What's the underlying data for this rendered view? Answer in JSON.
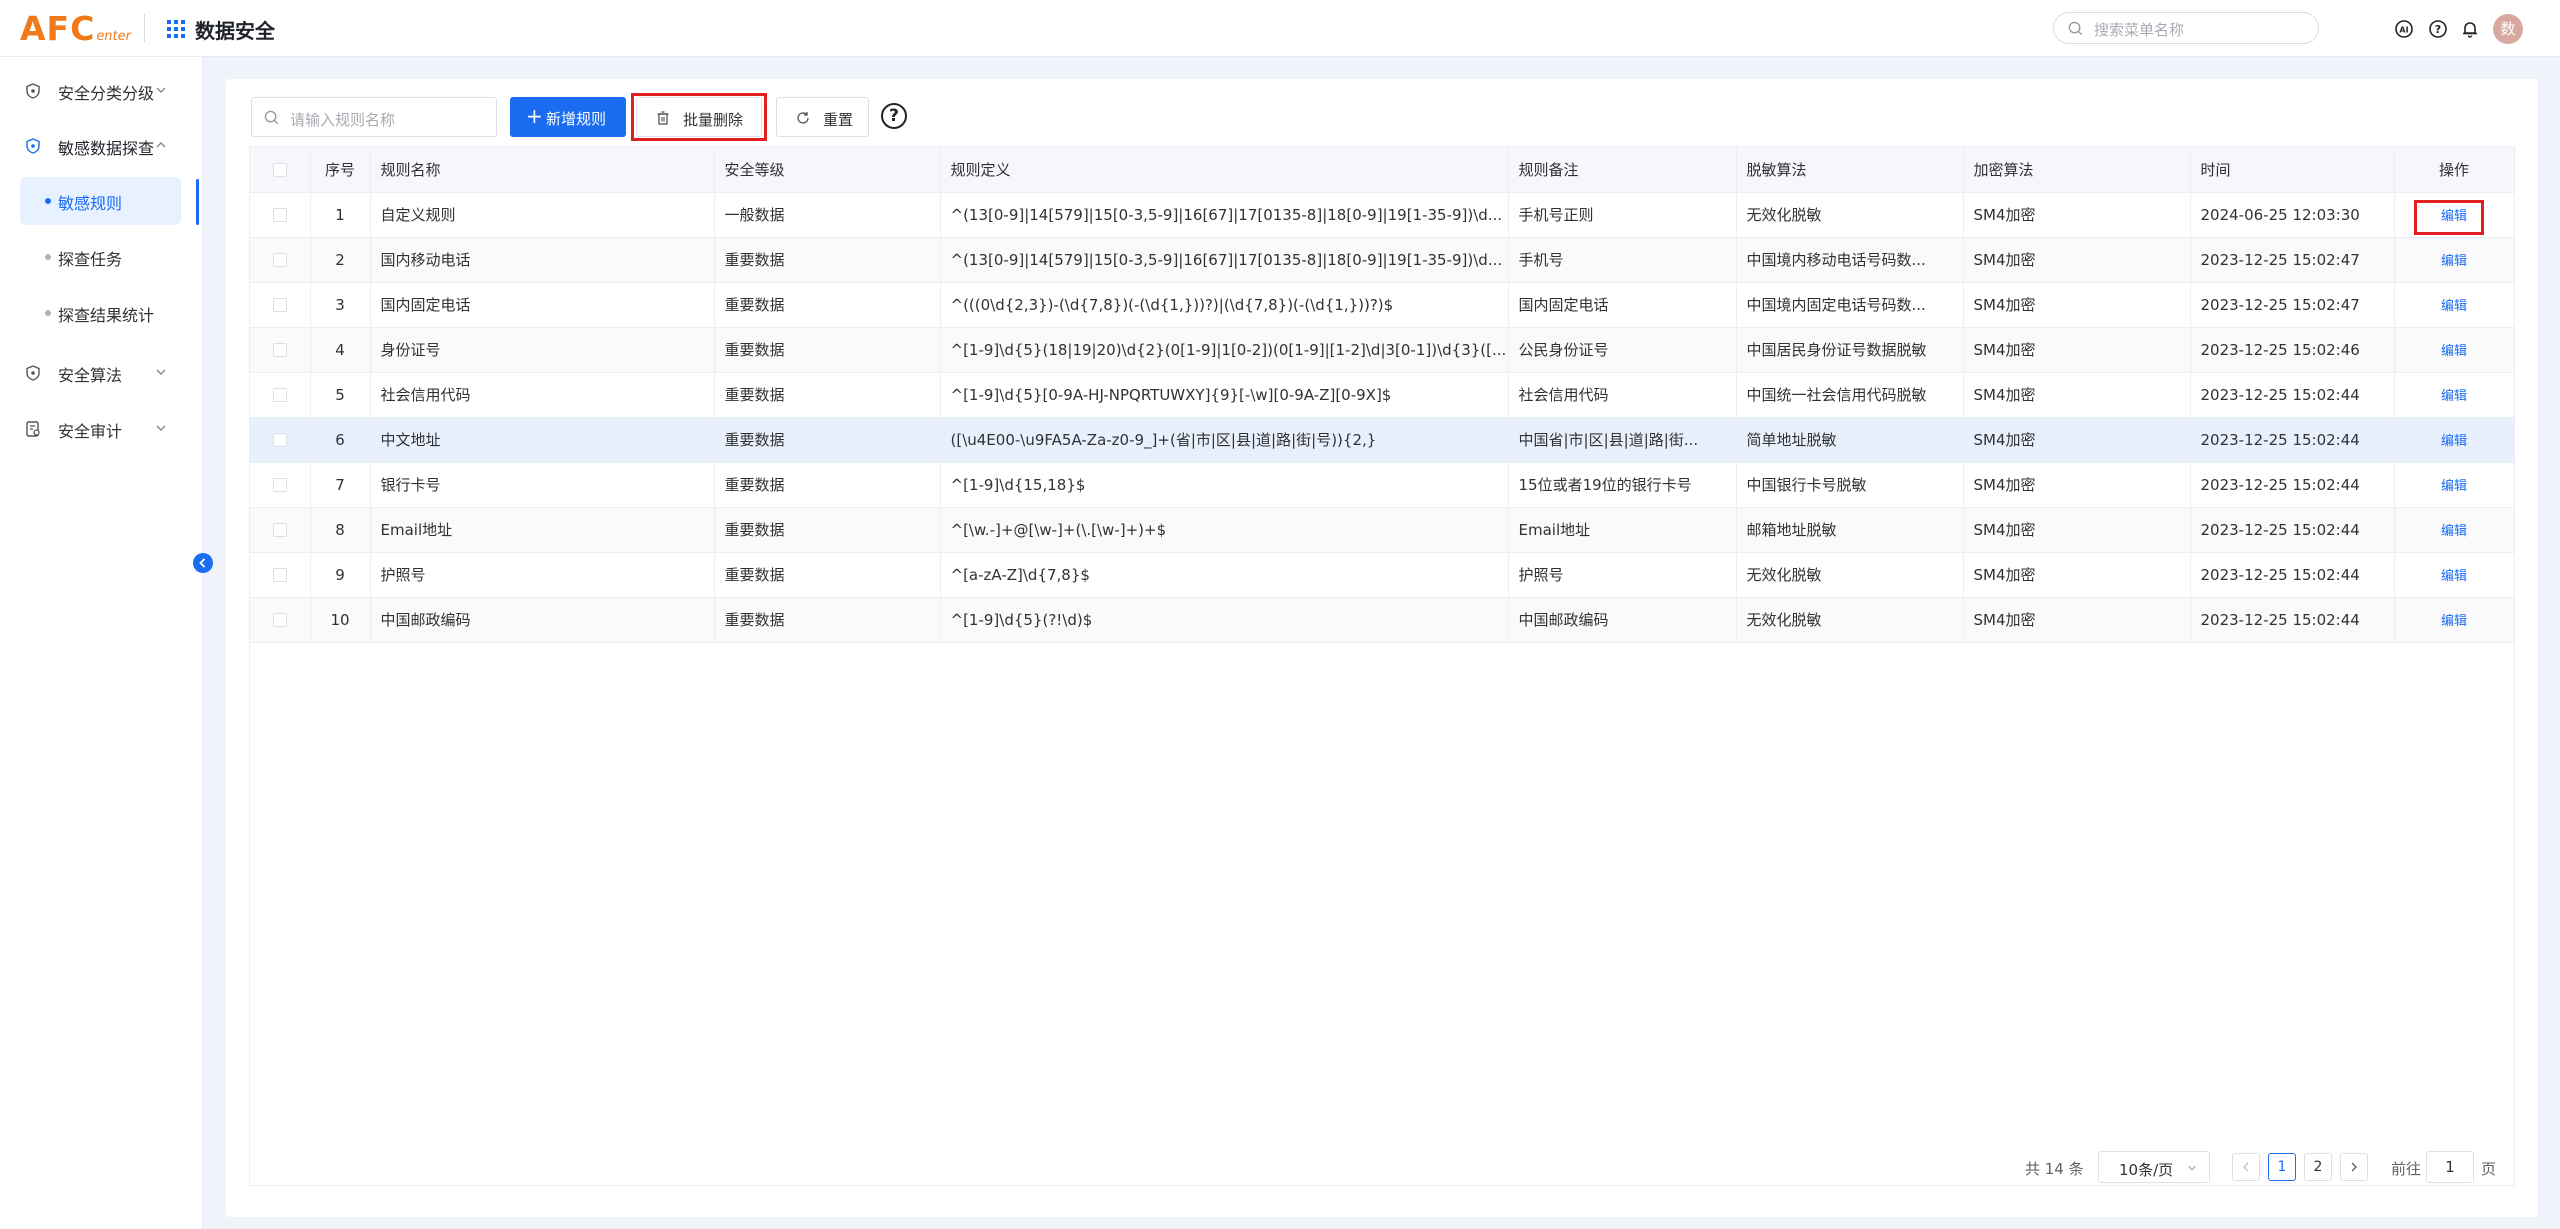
{
  "header": {
    "logo_main": "AFC",
    "logo_sub": "enter",
    "app_title": "数据安全",
    "search_placeholder": "搜索菜单名称",
    "avatar_text": "数"
  },
  "sidebar": {
    "items": [
      {
        "label": "安全分类分级"
      },
      {
        "label": "敏感数据探查"
      },
      {
        "label": "安全算法"
      },
      {
        "label": "安全审计"
      }
    ],
    "sub_items": [
      {
        "label": "敏感规则"
      },
      {
        "label": "探查任务"
      },
      {
        "label": "探查结果统计"
      }
    ]
  },
  "toolbar": {
    "search_placeholder": "请输入规则名称",
    "add_label": "新增规则",
    "batch_delete_label": "批量删除",
    "reset_label": "重置",
    "help_glyph": "?"
  },
  "table": {
    "headers": [
      "序号",
      "规则名称",
      "安全等级",
      "规则定义",
      "规则备注",
      "脱敏算法",
      "加密算法",
      "时间",
      "操作"
    ],
    "rows": [
      {
        "no": "1",
        "name": "自定义规则",
        "level": "一般数据",
        "def": "^(13[0-9]|14[579]|15[0-3,5-9]|16[67]|17[0135-8]|18[0-9]|19[1-35-9])\\d...",
        "note": "手机号正则",
        "mask": "无效化脱敏",
        "enc": "SM4加密",
        "time": "2024-06-25 12:03:30",
        "op": "编辑"
      },
      {
        "no": "2",
        "name": "国内移动电话",
        "level": "重要数据",
        "def": "^(13[0-9]|14[579]|15[0-3,5-9]|16[67]|17[0135-8]|18[0-9]|19[1-35-9])\\d...",
        "note": "手机号",
        "mask": "中国境内移动电话号码数...",
        "enc": "SM4加密",
        "time": "2023-12-25 15:02:47",
        "op": "编辑"
      },
      {
        "no": "3",
        "name": "国内固定电话",
        "level": "重要数据",
        "def": "^(((0\\d{2,3})-(\\d{7,8})(-(\\d{1,}))?)|(\\d{7,8})(-(\\d{1,}))?)$",
        "note": "国内固定电话",
        "mask": "中国境内固定电话号码数...",
        "enc": "SM4加密",
        "time": "2023-12-25 15:02:47",
        "op": "编辑"
      },
      {
        "no": "4",
        "name": "身份证号",
        "level": "重要数据",
        "def": "^[1-9]\\d{5}(18|19|20)\\d{2}(0[1-9]|1[0-2])(0[1-9]|[1-2]\\d|3[0-1])\\d{3}([...",
        "note": "公民身份证号",
        "mask": "中国居民身份证号数据脱敏",
        "enc": "SM4加密",
        "time": "2023-12-25 15:02:46",
        "op": "编辑"
      },
      {
        "no": "5",
        "name": "社会信用代码",
        "level": "重要数据",
        "def": "^[1-9]\\d{5}[0-9A-HJ-NPQRTUWXY]{9}[-\\w][0-9A-Z][0-9X]$",
        "note": "社会信用代码",
        "mask": "中国统一社会信用代码脱敏",
        "enc": "SM4加密",
        "time": "2023-12-25 15:02:44",
        "op": "编辑"
      },
      {
        "no": "6",
        "name": "中文地址",
        "level": "重要数据",
        "def": "([\\u4E00-\\u9FA5A-Za-z0-9_]+(省|市|区|县|道|路|街|号)){2,}",
        "note": "中国省|市|区|县|道|路|街...",
        "mask": "简单地址脱敏",
        "enc": "SM4加密",
        "time": "2023-12-25 15:02:44",
        "op": "编辑"
      },
      {
        "no": "7",
        "name": "银行卡号",
        "level": "重要数据",
        "def": "^[1-9]\\d{15,18}$",
        "note": "15位或者19位的银行卡号",
        "mask": "中国银行卡号脱敏",
        "enc": "SM4加密",
        "time": "2023-12-25 15:02:44",
        "op": "编辑"
      },
      {
        "no": "8",
        "name": "Email地址",
        "level": "重要数据",
        "def": "^[\\w.-]+@[\\w-]+(\\.[\\w-]+)+$",
        "note": "Email地址",
        "mask": "邮箱地址脱敏",
        "enc": "SM4加密",
        "time": "2023-12-25 15:02:44",
        "op": "编辑"
      },
      {
        "no": "9",
        "name": "护照号",
        "level": "重要数据",
        "def": "^[a-zA-Z]\\d{7,8}$",
        "note": "护照号",
        "mask": "无效化脱敏",
        "enc": "SM4加密",
        "time": "2023-12-25 15:02:44",
        "op": "编辑"
      },
      {
        "no": "10",
        "name": "中国邮政编码",
        "level": "重要数据",
        "def": "^[1-9]\\d{5}(?!\\d)$",
        "note": "中国邮政编码",
        "mask": "无效化脱敏",
        "enc": "SM4加密",
        "time": "2023-12-25 15:02:44",
        "op": "编辑"
      }
    ]
  },
  "pagination": {
    "total_text": "共 14 条",
    "page_size": "10条/页",
    "pages": [
      "1",
      "2"
    ],
    "goto_label": "前往",
    "goto_value": "1",
    "page_unit": "页"
  },
  "colors": {
    "primary": "#1a6cf0",
    "logo": "#f07a1a",
    "highlight_box": "#e02020"
  },
  "icons": [
    "apps-grid-icon",
    "search-icon",
    "ai-icon",
    "help-icon",
    "bell-icon",
    "shield-icon",
    "audit-icon",
    "chevron-down-icon",
    "chevron-up-icon",
    "chevron-left-icon",
    "plus-icon",
    "trash-icon",
    "refresh-icon"
  ]
}
